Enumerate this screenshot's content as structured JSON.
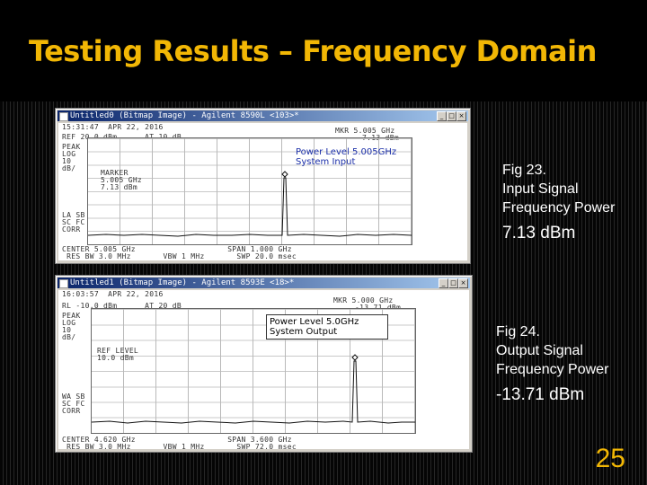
{
  "slide": {
    "title": "Testing Results – Frequency Domain",
    "page_number": "25",
    "title_color": "#f2b705"
  },
  "window1": {
    "title": "Untitled0 (Bitmap Image) - Agilent 8590L <103>*",
    "top_line": "15:31:47  APR 22, 2016",
    "ref_line": "REF 20.0 dBm      AT 10 dB",
    "mkr_line1": "MKR 5.005 GHz",
    "mkr_line2": "7.13 dBm",
    "left_labels": [
      "PEAK",
      "LOG",
      "10",
      "dB/"
    ],
    "marker_label": [
      "MARKER",
      "5.005 GHz",
      "7.13 dBm"
    ],
    "mode_labels": [
      "LA SB",
      "SC FC",
      "CORR"
    ],
    "box_line1": "Power Level 5.005GHz",
    "box_line2": "System Input",
    "bottom_line1": "CENTER 5.005 GHz                    SPAN 1.000 GHz",
    "bottom_line2": " RES BW 3.0 MHz       VBW 1 MHz       SWP 20.0 msec"
  },
  "window2": {
    "title": "Untitled1 (Bitmap Image) - Agilent 8593E <18>*",
    "top_line": "16:03:57  APR 22, 2016",
    "ref_line": "RL -10.0 dBm      AT 20 dB",
    "mkr_line1": "MKR 5.000 GHz",
    "mkr_line2": "-13.71 dBm",
    "left_labels": [
      "PEAK",
      "LOG",
      "10",
      "dB/"
    ],
    "marker_label": [
      "REF LEVEL",
      "10.0 dBm"
    ],
    "mode_labels": [
      "WA SB",
      "SC FC",
      "CORR"
    ],
    "box_line1": "Power Level 5.0GHz",
    "box_line2": "System Output",
    "bottom_line1": "CENTER 4.620 GHz                    SPAN 3.600 GHz",
    "bottom_line2": " RES BW 3.0 MHz       VBW 1 MHz       SWP 72.0 msec"
  },
  "caption1": {
    "fig": "Fig 23.",
    "line2": "Input  Signal",
    "line3": "Frequency Power",
    "value": "7.13 dBm"
  },
  "caption2": {
    "fig": "Fig 24.",
    "line2": "Output  Signal",
    "line3": "Frequency Power",
    "value": "-13.71 dBm"
  },
  "window_ctl_labels": [
    "_",
    "□",
    "×"
  ]
}
